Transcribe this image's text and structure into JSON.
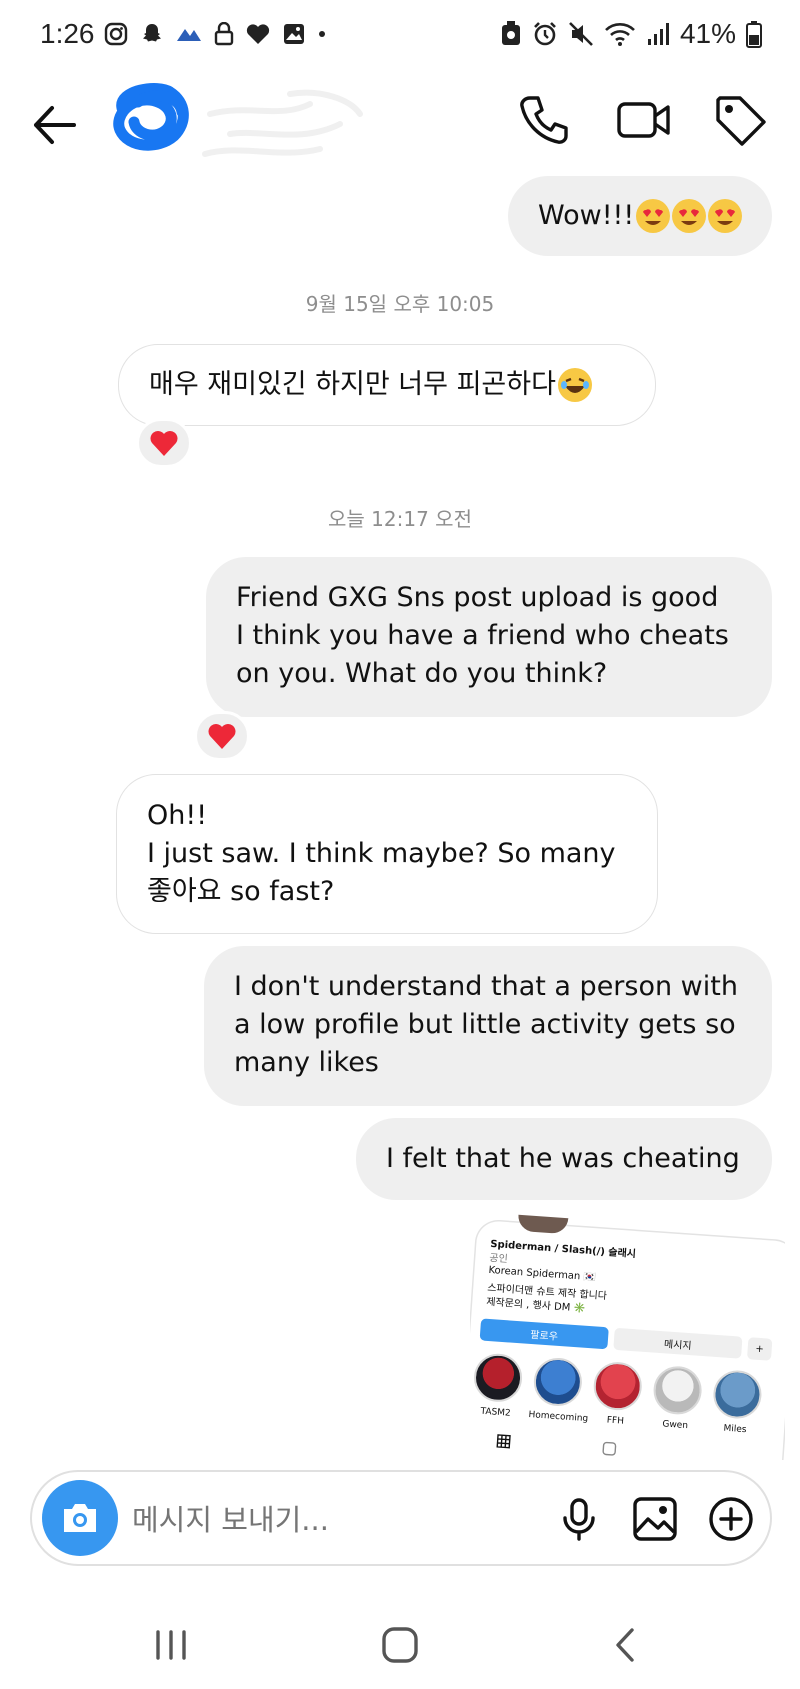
{
  "status_bar": {
    "time": "1:26",
    "battery": "41%"
  },
  "header": {
    "contact_name": "",
    "icons": [
      "back-arrow-icon",
      "phone-icon",
      "video-icon",
      "tag-icon"
    ]
  },
  "messages": {
    "m1": {
      "text": "Wow!!!"
    },
    "ts1": "9월 15일 오후 10:05",
    "m2": {
      "text": "매우 재미있긴 하지만 너무 피곤하다"
    },
    "ts2": "오늘 12:17 오전",
    "m3": {
      "lines": [
        "Friend GXG Sns post upload is good",
        "I think you have a friend who cheats",
        "on you. What do you think?"
      ]
    },
    "m4": {
      "lines": [
        "Oh!!",
        "I just saw. I think maybe? So many",
        "좋아요 so fast?"
      ]
    },
    "m5": {
      "lines": [
        "I don't understand that a person with",
        "a low profile but little activity gets so",
        "many likes"
      ]
    },
    "m6": {
      "text": "I felt that he was cheating"
    }
  },
  "shared_profile": {
    "name": "Spiderman / Slash(/) 슬래시",
    "category": "공인",
    "bio_line1": "Korean Spiderman 🇰🇷",
    "bio_line2": "스파이더맨 슈트 제작 합니다",
    "bio_line3": "제작문의 , 행사 DM ✳️",
    "follow_label": "팔로우",
    "message_label": "메시지",
    "add_label": "+",
    "highlights": [
      "TASM2",
      "Homecoming",
      "FFH",
      "Gwen",
      "Miles"
    ]
  },
  "composer": {
    "placeholder": "메시지 보내기..."
  },
  "colors": {
    "accent": "#3797f0",
    "bubble_out": "#efefef",
    "timestamp": "#8e8e8e",
    "heart": "#ed4956"
  }
}
